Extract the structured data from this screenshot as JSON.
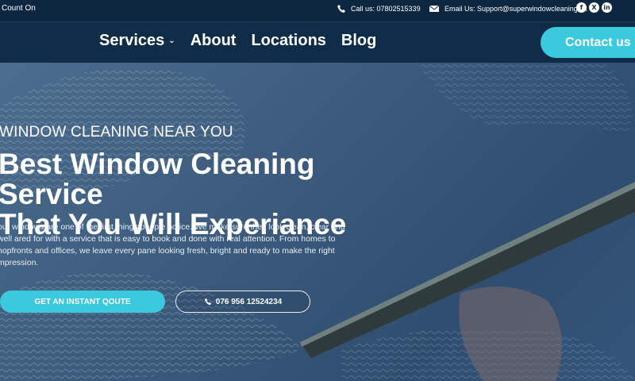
{
  "topbar": {
    "tagline": "Count On",
    "phone_label": "Call us: 07802515339",
    "email_label": "Email Us: Support@superwindowcleaning.uk",
    "socials": [
      "f",
      "X",
      "in"
    ]
  },
  "nav": {
    "items": [
      {
        "label": "Services",
        "has_dropdown": true
      },
      {
        "label": "About"
      },
      {
        "label": "Locations"
      },
      {
        "label": "Blog"
      }
    ],
    "contact_label": "Contact us"
  },
  "hero": {
    "eyebrow": "WINDOW CLEANING NEAR YOU",
    "headline_line1": "Best Window Cleaning Service",
    "headline_line2": "That You Will Experiance",
    "description": "our windows are one of the first things people notice. We make sure they look clean, clear and well ared for with a service that is easy to book and done with real attention. From homes to hopfronts and offices, we leave every pane looking fresh, bright and ready to make the right mpression.",
    "primary_cta": "GET AN INSTANT QOUTE",
    "secondary_cta": "076 956 12524234"
  },
  "colors": {
    "accent": "#3bc9dd",
    "topbar_bg": "#0e2741",
    "nav_bg": "#0f2d48"
  },
  "icons": {
    "phone": "phone-icon",
    "email": "envelope-icon",
    "dropdown": "chevron-down-icon"
  }
}
